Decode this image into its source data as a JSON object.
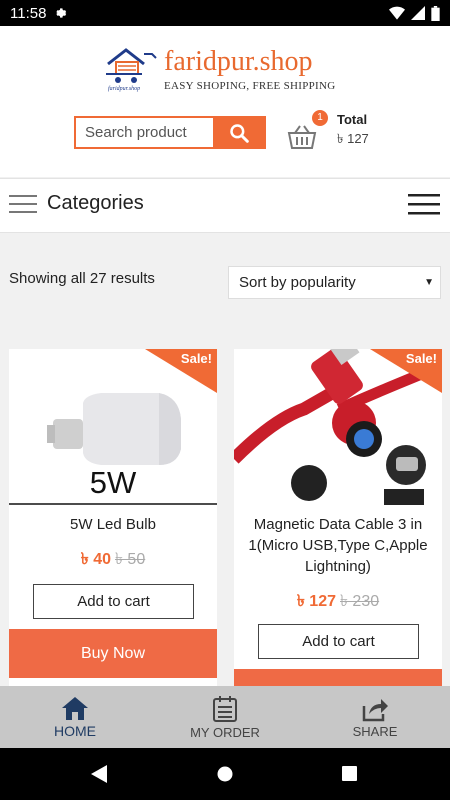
{
  "status_bar": {
    "time": "11:58"
  },
  "header": {
    "brand": "faridpur.shop",
    "tagline": "EASY SHOPING, FREE SHIPPING",
    "logo_small": "faridpur.shop",
    "search": {
      "placeholder": "Search product"
    },
    "cart": {
      "count": "1",
      "total_label": "Total",
      "total_amount": "৳ 127"
    }
  },
  "categories": {
    "label": "Categories"
  },
  "results": {
    "text": "Showing all 27 results",
    "sort": "Sort by popularity"
  },
  "products": [
    {
      "image_caption": "5W",
      "sale": "Sale!",
      "name": "5W Led Bulb",
      "price": "৳ 40",
      "old_price": "৳ 50",
      "add_to_cart": "Add to cart",
      "buy_now": "Buy Now"
    },
    {
      "sale": "Sale!",
      "name": "Magnetic Data Cable 3 in 1(Micro USB,Type C,Apple Lightning)",
      "price": "৳ 127",
      "old_price": "৳ 230",
      "add_to_cart": "Add to cart"
    }
  ],
  "bottom_nav": [
    {
      "label": "HOME",
      "icon": "home-icon"
    },
    {
      "label": "MY ORDER",
      "icon": "order-list-icon"
    },
    {
      "label": "SHARE",
      "icon": "share-icon"
    }
  ],
  "colors": {
    "accent": "#f06a35",
    "brand_blue": "#1f3b8a",
    "nav_active": "#1f3b63"
  }
}
